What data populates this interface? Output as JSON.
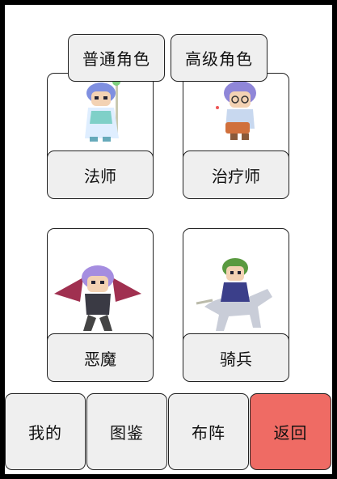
{
  "tabs": [
    {
      "label": "普通角色"
    },
    {
      "label": "高级角色"
    }
  ],
  "characters": [
    {
      "name": "法师",
      "icon": "mage-sprite-icon"
    },
    {
      "name": "治疗师",
      "icon": "healer-sprite-icon"
    },
    {
      "name": "恶魔",
      "icon": "demon-sprite-icon"
    },
    {
      "name": "骑兵",
      "icon": "cavalry-sprite-icon"
    }
  ],
  "bottom_nav": [
    {
      "label": "我的"
    },
    {
      "label": "图鉴"
    },
    {
      "label": "布阵"
    },
    {
      "label": "返回"
    }
  ],
  "colors": {
    "button_bg": "#efefef",
    "return_bg": "#ef6b64",
    "border": "#222222"
  }
}
